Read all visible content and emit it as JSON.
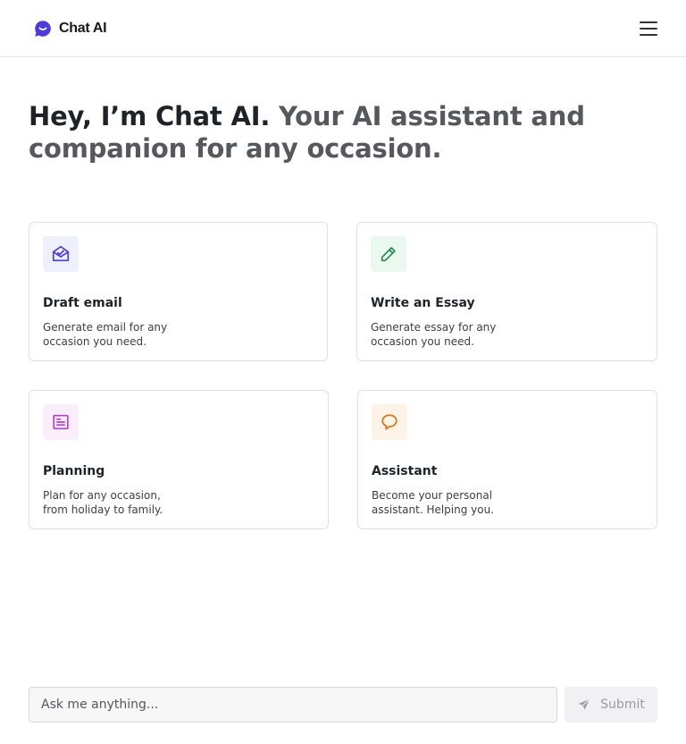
{
  "app": {
    "name": "Chat AI",
    "logo_icon": "chat-smile-icon",
    "menu_icon": "hamburger-icon",
    "accent_color": "#4f3bd6"
  },
  "hero": {
    "greeting": "Hey, I’m Chat AI.",
    "tagline": " Your AI assistant and companion for any occasion."
  },
  "cards": [
    {
      "title": "Draft email",
      "description": "Generate email for any occasion you need.",
      "icon": "open-envelope-icon",
      "icon_color": "#4f3bd6",
      "icon_bg": "#eef0fb"
    },
    {
      "title": "Write an Essay",
      "description": "Generate essay for any occasion you need.",
      "icon": "pencil-icon",
      "icon_color": "#1f8a4c",
      "icon_bg": "#eaf8ef"
    },
    {
      "title": "Planning",
      "description": "Plan for any occasion, from holiday to family.",
      "icon": "list-document-icon",
      "icon_color": "#b13fc7",
      "icon_bg": "#fbeefb"
    },
    {
      "title": "Assistant",
      "description": "Become your personal assistant. Helping you.",
      "icon": "speech-bubble-icon",
      "icon_color": "#e0731f",
      "icon_bg": "#fdf3e6"
    }
  ],
  "composer": {
    "placeholder": "Ask me anything...",
    "value": "",
    "submit_label": "Submit",
    "submit_icon": "send-icon"
  }
}
